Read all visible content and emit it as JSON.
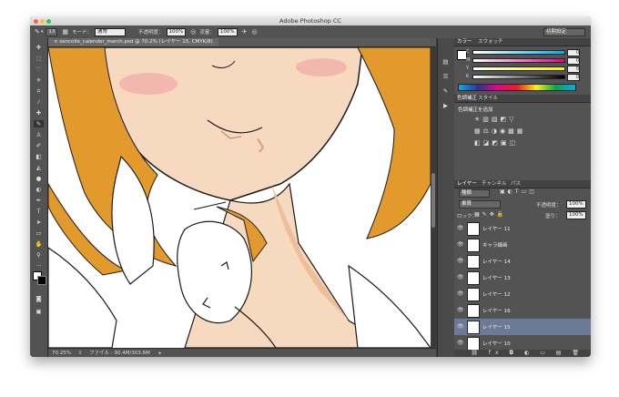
{
  "window": {
    "title": "Adobe Photoshop CC"
  },
  "options_bar": {
    "brush_size": "13",
    "mode_label": "モード：",
    "mode_value": "通常",
    "opacity_label": "不透明度：",
    "opacity_value": "100%",
    "flow_label": "流量：",
    "flow_value": "100%",
    "workspace": "初期設定"
  },
  "document": {
    "tab_title": "× sencolle_calender_march.psd @ 70.2% (レイヤー 15, CMYK/8)"
  },
  "status": {
    "zoom": "70.25%",
    "file_info": "ファイル : 90.4M/303.6M"
  },
  "color_panel": {
    "tabs": [
      "カラー",
      "スウォッチ"
    ],
    "channels": [
      {
        "label": "C",
        "value": "0"
      },
      {
        "label": "M",
        "value": "0"
      },
      {
        "label": "Y",
        "value": "0"
      },
      {
        "label": "K",
        "value": "0"
      }
    ]
  },
  "adjustments_panel": {
    "tabs": [
      "色調補正",
      "スタイル"
    ],
    "heading": "色調補正を追加"
  },
  "layers_panel": {
    "tabs": [
      "レイヤー",
      "チャンネル",
      "パス"
    ],
    "filter": "種類",
    "blend_mode": "乗算",
    "opacity_label": "不透明度：",
    "opacity_value": "100%",
    "lock_label": "ロック：",
    "fill_label": "塗り：",
    "fill_value": "100%",
    "layers": [
      {
        "name": "レイヤー 11",
        "selected": false
      },
      {
        "name": "キャラ線画",
        "selected": false
      },
      {
        "name": "レイヤー 14",
        "selected": false
      },
      {
        "name": "レイヤー 13",
        "selected": false
      },
      {
        "name": "レイヤー 12",
        "selected": false
      },
      {
        "name": "レイヤー 16",
        "selected": false
      },
      {
        "name": "レイヤー 15",
        "selected": true
      },
      {
        "name": "レイヤー 10",
        "selected": false
      }
    ]
  },
  "colors": {
    "hair": "#E39A2C",
    "skin": "#F7D9C0",
    "skin_shadow": "#EDBE9A",
    "selected_layer": "#6D7A96"
  }
}
